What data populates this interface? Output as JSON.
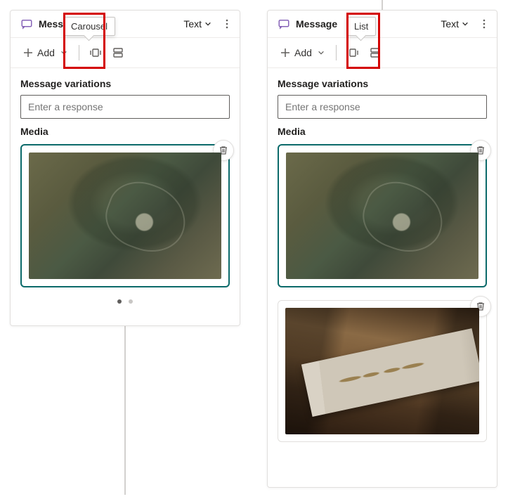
{
  "header": {
    "title": "Message",
    "text_dropdown": "Text"
  },
  "toolbar": {
    "add_label": "Add"
  },
  "tooltips": {
    "carousel": "Carousel",
    "list": "List"
  },
  "sections": {
    "variations": "Message variations",
    "media": "Media"
  },
  "input": {
    "placeholder": "Enter a response"
  }
}
